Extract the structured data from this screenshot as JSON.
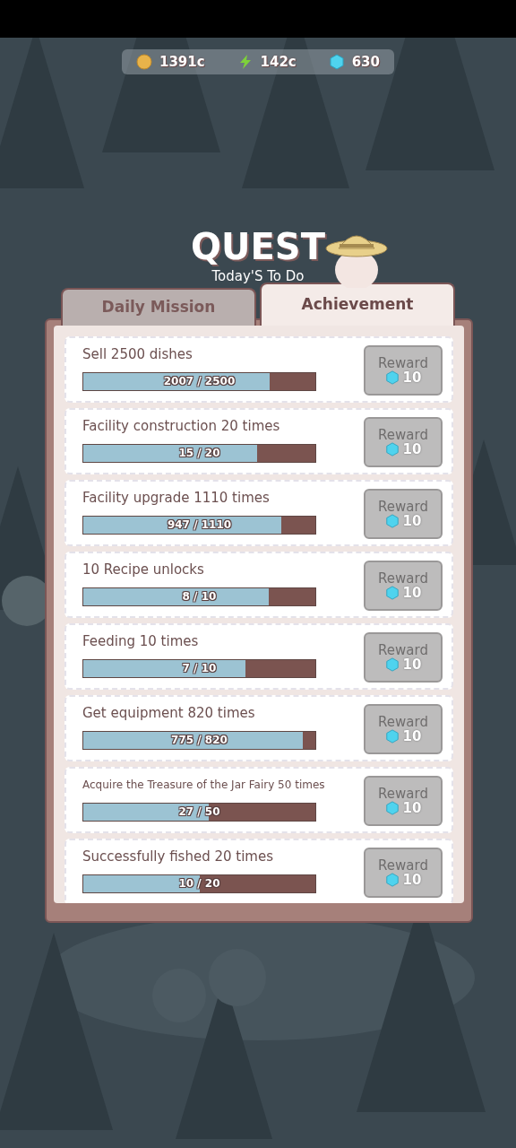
{
  "currencies": [
    {
      "kind": "coin",
      "amount": "1391c"
    },
    {
      "kind": "energy",
      "amount": "142c"
    },
    {
      "kind": "gem",
      "amount": "630"
    }
  ],
  "header": {
    "title": "QUEST",
    "subtitle": "Today'S To Do"
  },
  "tabs": [
    {
      "label": "Daily Mission",
      "selected": false
    },
    {
      "label": "Achievement",
      "selected": true
    }
  ],
  "quests": [
    {
      "title": "Sell 2500 dishes",
      "progress": "2007 / 2500",
      "level": 0.803,
      "reward": {
        "label": "Reward",
        "amount": "10",
        "disabled": true
      }
    },
    {
      "title": "Facility construction 20 times",
      "progress": "15 / 20",
      "level": 0.75,
      "reward": {
        "label": "Reward",
        "amount": "10",
        "disabled": true
      }
    },
    {
      "title": "Facility upgrade 1110 times",
      "progress": "947 / 1110",
      "level": 0.853,
      "reward": {
        "label": "Reward",
        "amount": "10",
        "disabled": true
      }
    },
    {
      "title": "10 Recipe unlocks",
      "progress": "8 / 10",
      "level": 0.8,
      "reward": {
        "label": "Reward",
        "amount": "10",
        "disabled": true
      }
    },
    {
      "title": "Feeding 10 times",
      "progress": "7 / 10",
      "level": 0.7,
      "reward": {
        "label": "Reward",
        "amount": "10",
        "disabled": true
      }
    },
    {
      "title": "Get equipment 820 times",
      "progress": "775 / 820",
      "level": 0.945,
      "reward": {
        "label": "Reward",
        "amount": "10",
        "disabled": true
      }
    },
    {
      "title": "Acquire the Treasure of the Jar Fairy 50 times",
      "progress": "27 / 50",
      "level": 0.54,
      "reward": {
        "label": "Reward",
        "amount": "10",
        "disabled": true
      }
    },
    {
      "title": "Successfully fished 20 times",
      "progress": "10 / 20",
      "level": 0.5,
      "reward": {
        "label": "Reward",
        "amount": "10",
        "disabled": true
      }
    }
  ]
}
